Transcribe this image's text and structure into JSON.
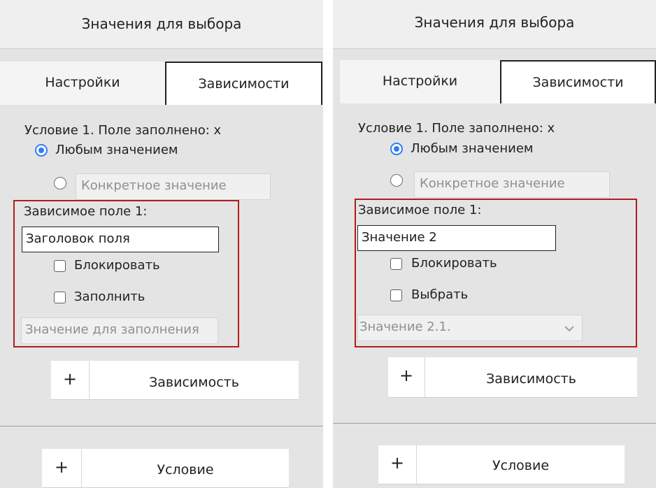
{
  "panels": [
    {
      "header_title": "Значения для выбора",
      "tabs": [
        "Настройки",
        "Зависимости"
      ],
      "condition_label": "Условие 1. Поле заполнено: x",
      "radio_any_label": "Любым значением",
      "specific_value_placeholder": "Конкретное значение",
      "dependent_field_label": "Зависимое поле 1:",
      "dependent_field_value": "Заголовок поля",
      "block_label": "Блокировать",
      "fill_label": "Заполнить",
      "fill_value_placeholder": "Значение для заполнения",
      "dependency_button": "Зависимость",
      "condition_button": "Условие",
      "plus": "+"
    },
    {
      "header_title": "Значения для выбора",
      "tabs": [
        "Настройки",
        "Зависимости"
      ],
      "condition_label": "Условие 1. Поле заполнено: x",
      "radio_any_label": "Любым значением",
      "specific_value_placeholder": "Конкретное значение",
      "dependent_field_label": "Зависимое поле 1:",
      "dependent_field_value": "Значение 2",
      "block_label": "Блокировать",
      "select_label": "Выбрать",
      "select_value": "Значение 2.1.",
      "dependency_button": "Зависимость",
      "condition_button": "Условие",
      "plus": "+"
    }
  ],
  "colors": {
    "panel_background": "#e4e4e4",
    "accent_radio": "#2f7df5",
    "highlight_border": "#b11c1c"
  }
}
